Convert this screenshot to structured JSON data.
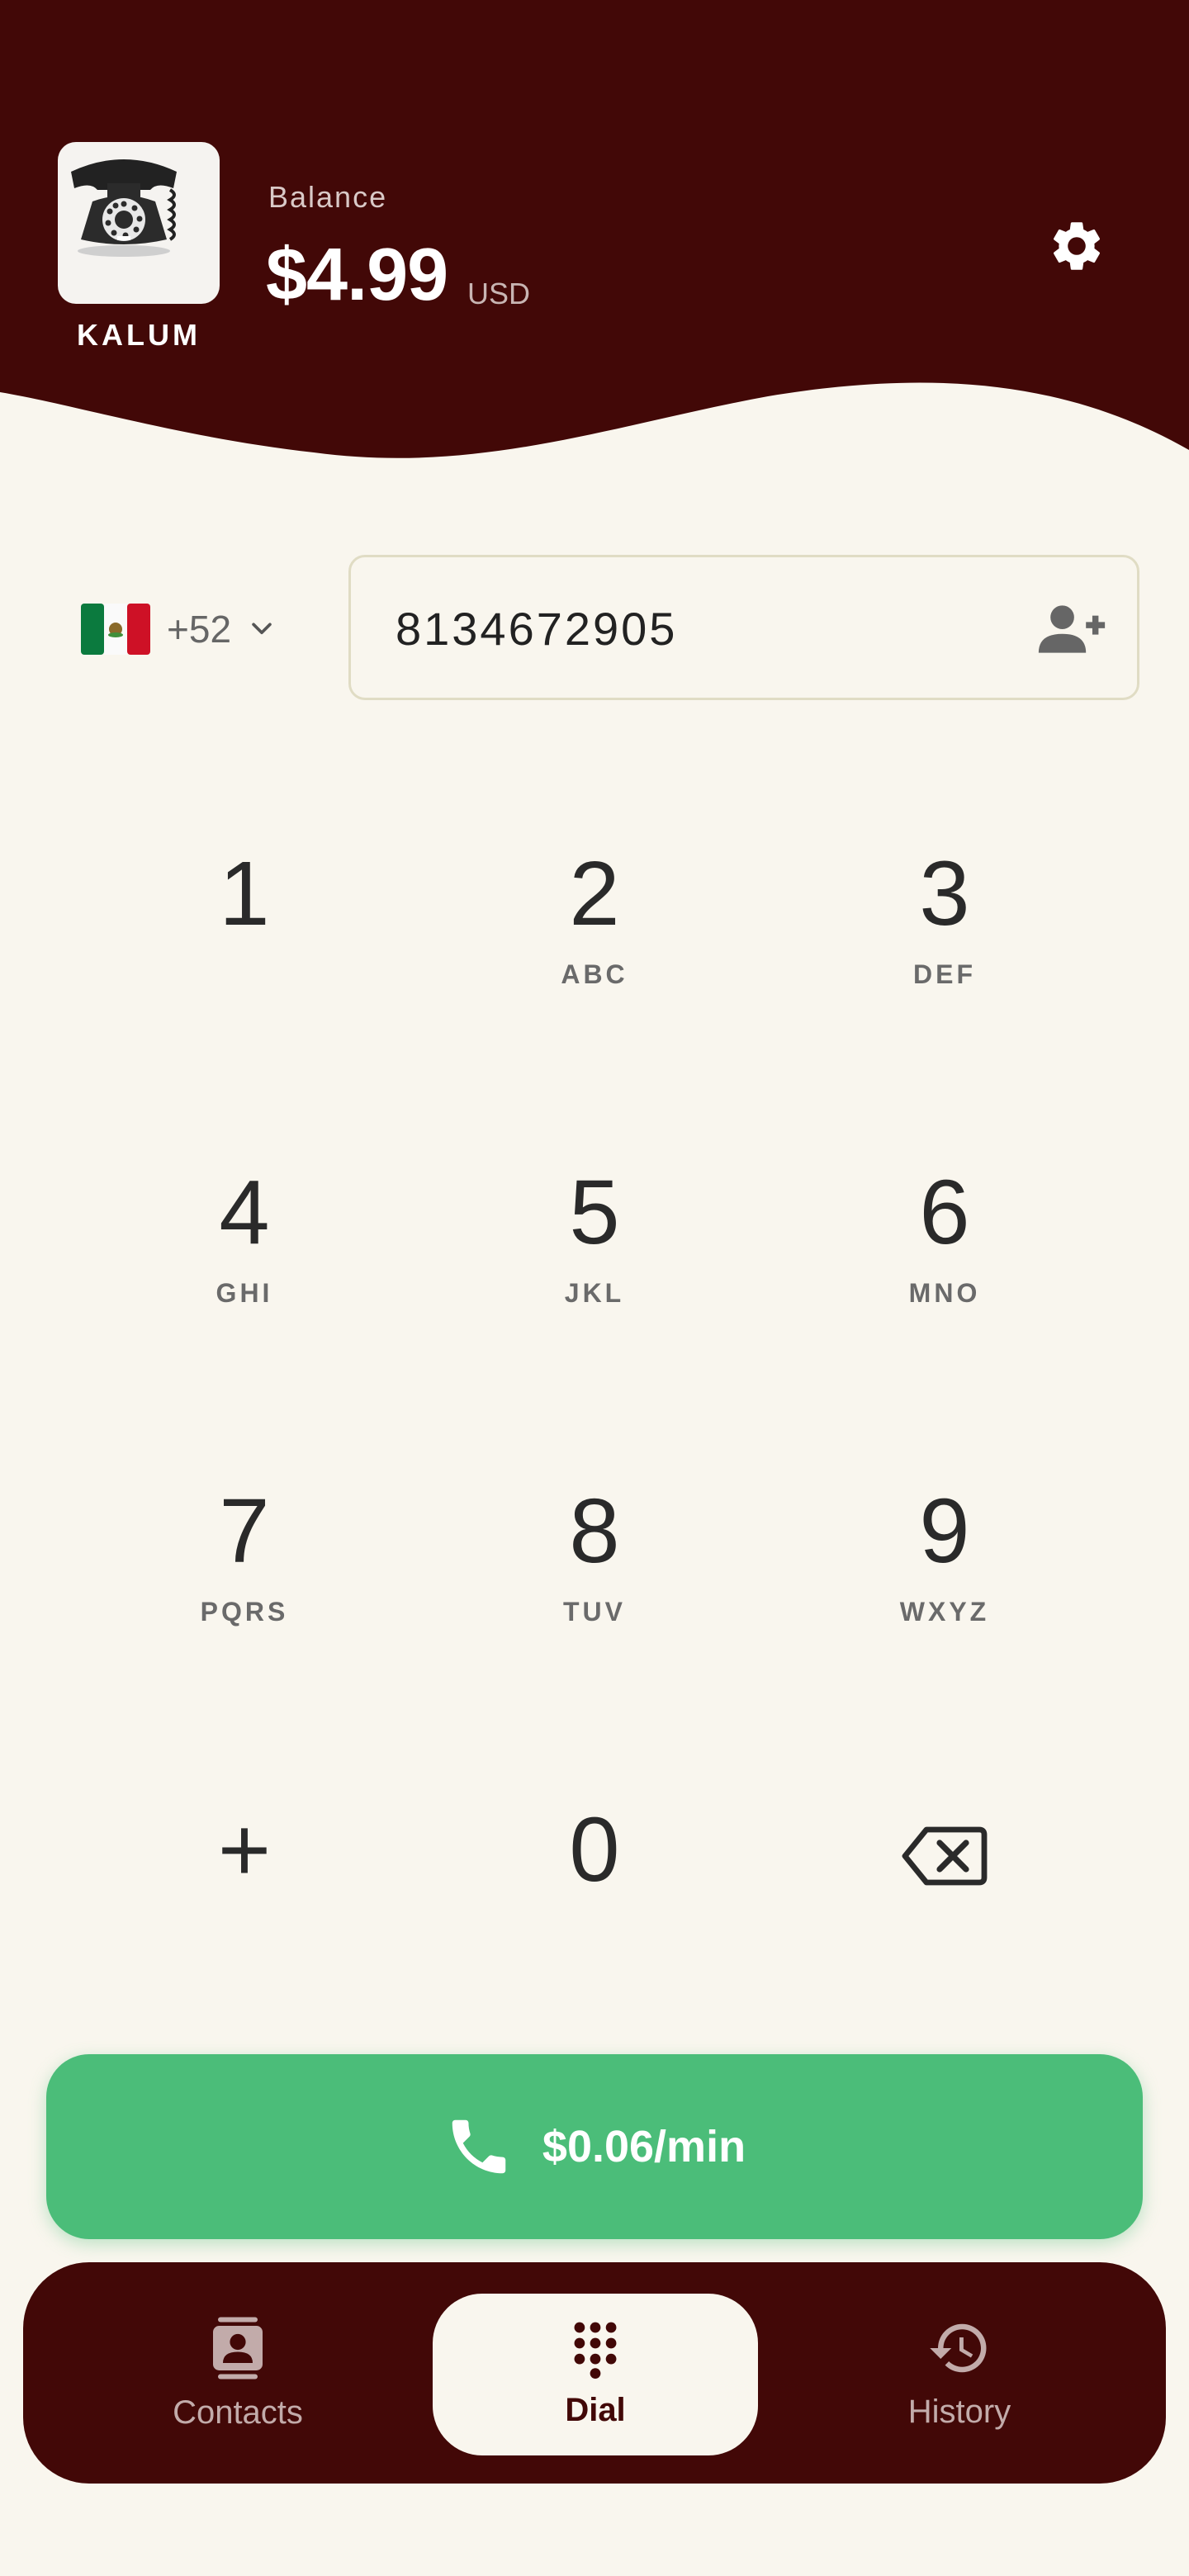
{
  "app": {
    "name": "KALUM"
  },
  "balance": {
    "label": "Balance",
    "amount": "$4.99",
    "currency": "USD"
  },
  "dialer": {
    "country": {
      "flag": "mexico-flag",
      "code": "+52"
    },
    "number": "8134672905"
  },
  "keypad": [
    {
      "digit": "1",
      "letters": ""
    },
    {
      "digit": "2",
      "letters": "ABC"
    },
    {
      "digit": "3",
      "letters": "DEF"
    },
    {
      "digit": "4",
      "letters": "GHI"
    },
    {
      "digit": "5",
      "letters": "JKL"
    },
    {
      "digit": "6",
      "letters": "MNO"
    },
    {
      "digit": "7",
      "letters": "PQRS"
    },
    {
      "digit": "8",
      "letters": "TUV"
    },
    {
      "digit": "9",
      "letters": "WXYZ"
    },
    {
      "digit": "+",
      "letters": ""
    },
    {
      "digit": "0",
      "letters": ""
    },
    {
      "digit": "backspace-icon",
      "letters": ""
    }
  ],
  "call": {
    "rate": "$0.06/min"
  },
  "nav": [
    {
      "label": "Contacts",
      "icon": "contacts-icon"
    },
    {
      "label": "Dial",
      "icon": "dialpad-icon",
      "active": true
    },
    {
      "label": "History",
      "icon": "history-icon"
    }
  ],
  "colors": {
    "header": "#420807",
    "background": "#f9f6ee",
    "call": "#4bbd79"
  }
}
